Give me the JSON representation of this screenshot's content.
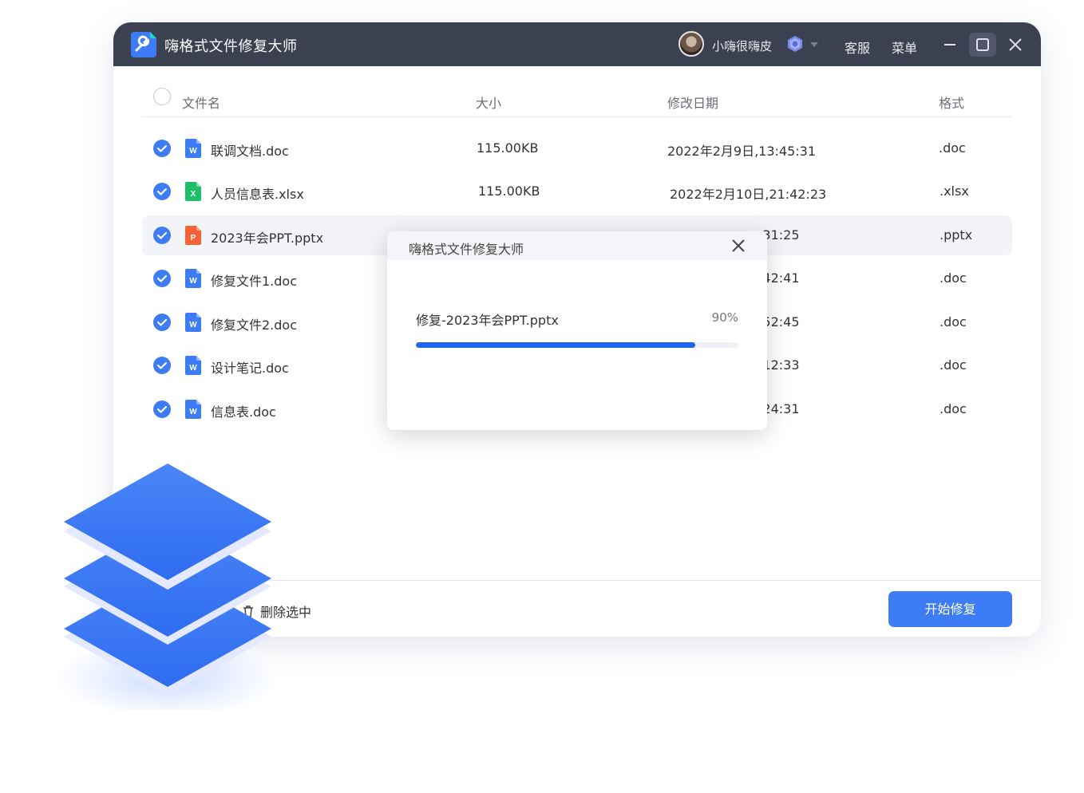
{
  "app": {
    "title": "嗨格式文件修复大师"
  },
  "user": {
    "name": "小嗨很嗨皮"
  },
  "titlebar": {
    "service": "客服",
    "menu": "菜单"
  },
  "table": {
    "headers": {
      "name": "文件名",
      "size": "大小",
      "date": "修改日期",
      "format": "格式"
    },
    "rows": [
      {
        "name": "联调文档.doc",
        "size": "115.00KB",
        "date": "2022年2月9日,13:45:31",
        "format": ".doc",
        "type": "word",
        "checked": true
      },
      {
        "name": "人员信息表.xlsx",
        "size": "115.00KB",
        "date": "2022年2月10日,21:42:23",
        "format": ".xlsx",
        "type": "excel",
        "checked": true
      },
      {
        "name": "2023年会PPT.pptx",
        "size": "",
        "date": ":31:25",
        "format": ".pptx",
        "type": "ppt",
        "checked": true
      },
      {
        "name": "修复文件1.doc",
        "size": "",
        "date": ":42:41",
        "format": ".doc",
        "type": "word",
        "checked": true
      },
      {
        "name": "修复文件2.doc",
        "size": "",
        "date": ":52:45",
        "format": ".doc",
        "type": "word",
        "checked": true
      },
      {
        "name": "设计笔记.doc",
        "size": "",
        "date": ":12:33",
        "format": ".doc",
        "type": "word",
        "checked": true
      },
      {
        "name": "信息表.doc",
        "size": "",
        "date": ":24:31",
        "format": ".doc",
        "type": "word",
        "checked": true
      }
    ]
  },
  "footer": {
    "delete_label": "删除选中",
    "repair_label": "开始修复"
  },
  "dialog": {
    "title": "嗨格式文件修复大师",
    "progress_label": "修复-2023年会PPT.pptx",
    "progress_text": "90%",
    "progress_fraction": 0.9
  },
  "colors": {
    "accent": "#3d7cf5",
    "titlebar": "#3c4151",
    "word": "#3d7cf5",
    "excel": "#1fbf6a",
    "ppt": "#f4623a"
  },
  "icons": [
    "app-logo-icon",
    "vip-badge-icon",
    "chevron-down-icon",
    "minimize-icon",
    "maximize-icon",
    "close-icon",
    "checkbox-checked-icon",
    "word-file-icon",
    "excel-file-icon",
    "ppt-file-icon",
    "trash-icon",
    "layers-icon"
  ]
}
